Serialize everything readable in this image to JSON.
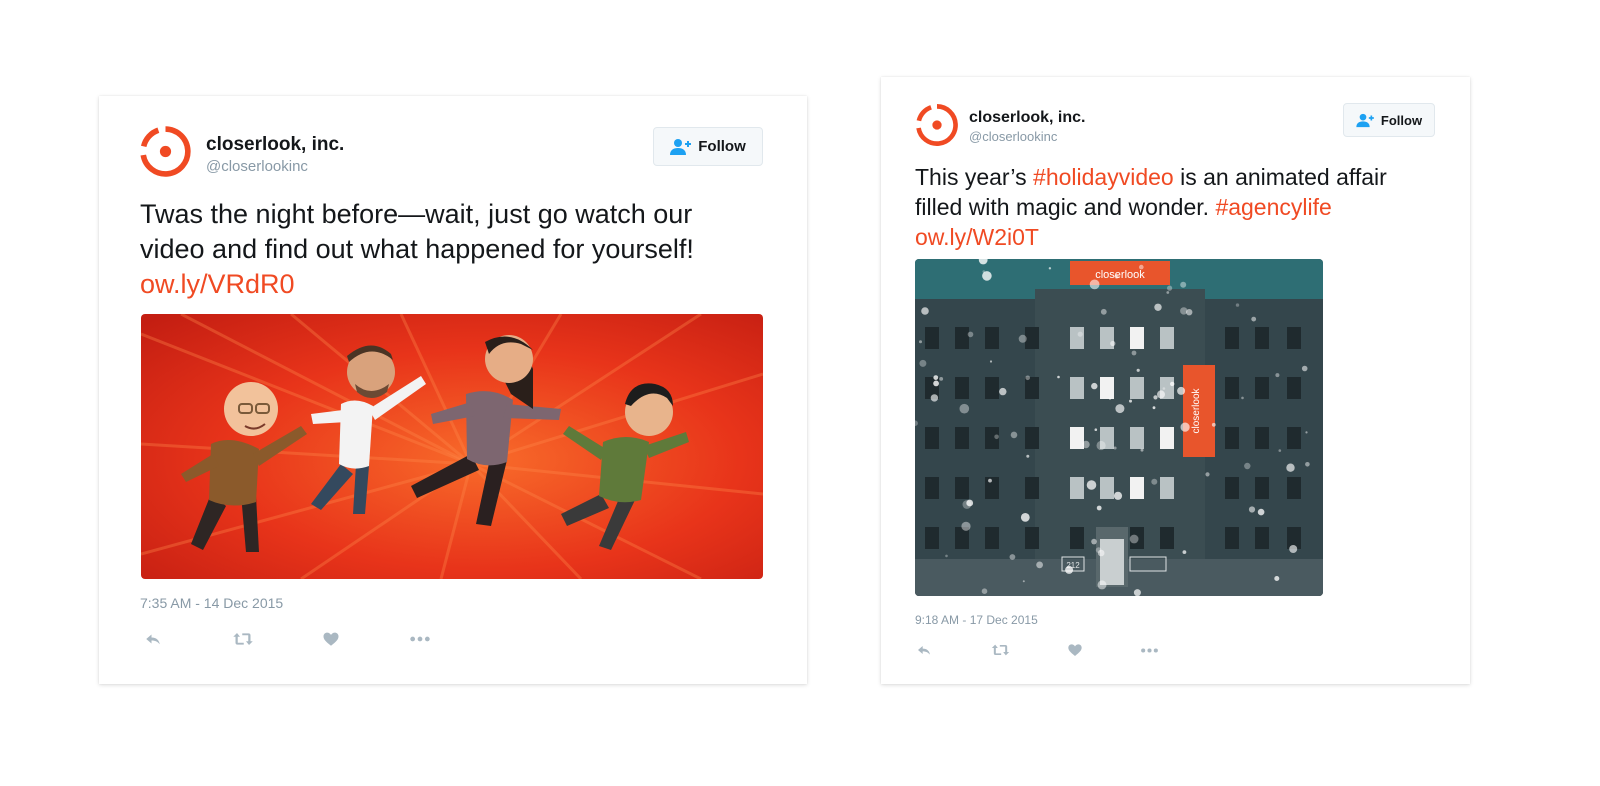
{
  "tweets": [
    {
      "name": "closerlook, inc.",
      "handle": "@closerlookinc",
      "follow_label": "Follow",
      "text_line1": "Twas the night before—wait, just go watch our",
      "text_line2": "video and find out what happened for yourself!",
      "link": "ow.ly/VRdR0",
      "timestamp": "7:35 AM - 14 Dec 2015",
      "media_icon": "animated-characters-jumping"
    },
    {
      "name": "closerlook, inc.",
      "handle": "@closerlookinc",
      "follow_label": "Follow",
      "text_prefix": "This year’s ",
      "hashtag1": "#holidayvideo",
      "text_middle": " is an animated affair",
      "text_line2": "filled with magic and wonder. ",
      "hashtag2": "#agencylife",
      "link": "ow.ly/W2i0T",
      "timestamp": "9:18 AM - 17 Dec 2015",
      "media_icon": "snowy-building-illustration",
      "banner_text": "closerlook",
      "door_number": "212"
    }
  ],
  "colors": {
    "brand": "#f04a23",
    "text": "#14171a",
    "muted": "#8899a6",
    "action_icon": "#aab8c2",
    "follow_icon": "#1da1f2"
  },
  "icons": [
    "closerlook-logo-icon",
    "follow-person-icon",
    "reply-icon",
    "retweet-icon",
    "like-icon",
    "more-icon"
  ]
}
